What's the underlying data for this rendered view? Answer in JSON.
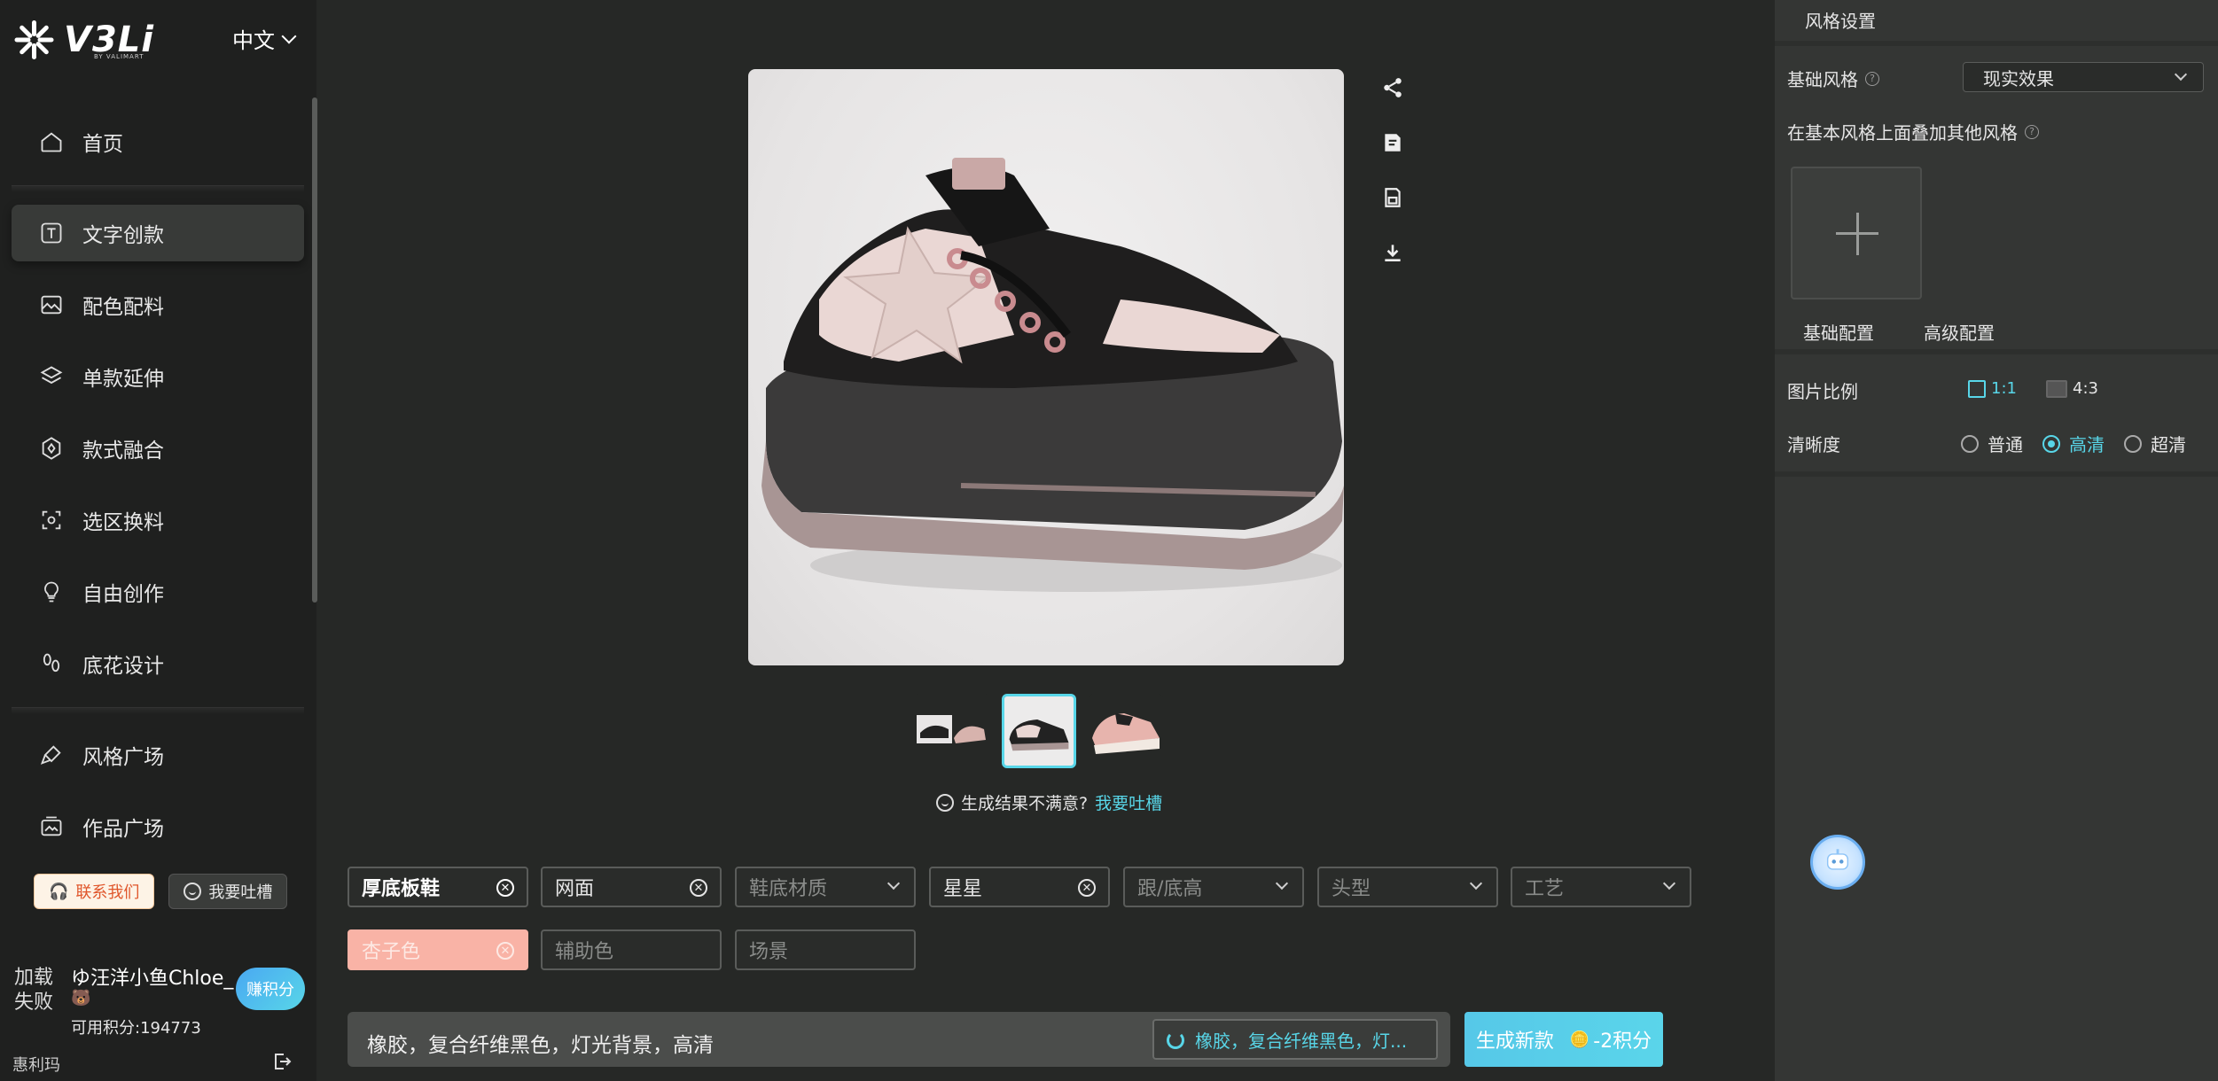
{
  "brand": {
    "logo_text": "V3Li",
    "logo_sub": "BY VALIMART"
  },
  "header": {
    "language": "中文"
  },
  "sidebar": {
    "items": [
      {
        "label": "首页",
        "icon": "home-icon"
      },
      {
        "label": "文字创款",
        "icon": "text-icon",
        "active": true
      },
      {
        "label": "配色配料",
        "icon": "palette-icon"
      },
      {
        "label": "单款延伸",
        "icon": "layers-icon"
      },
      {
        "label": "款式融合",
        "icon": "fusion-icon"
      },
      {
        "label": "选区换料",
        "icon": "select-area-icon"
      },
      {
        "label": "自由创作",
        "icon": "lightbulb-icon"
      },
      {
        "label": "底花设计",
        "icon": "footprint-icon"
      }
    ],
    "items2": [
      {
        "label": "风格广场",
        "icon": "brush-icon"
      },
      {
        "label": "作品广场",
        "icon": "gallery-icon"
      }
    ],
    "contact_label": "联系我们",
    "feedback_label": "我要吐槽"
  },
  "user": {
    "avatar_fail": "加载失败",
    "name": "ゆ汪洋小鱼Chloe_",
    "emoji": "🐻",
    "points_label": "可用积分:194773",
    "earn_label": "赚积分",
    "shop": "惠利玛"
  },
  "main": {
    "dissatisfied_text": "生成结果不满意?",
    "feedback_link": "我要吐槽",
    "tags": [
      {
        "value": "厚底板鞋",
        "type": "filled-bold"
      },
      {
        "value": "网面",
        "type": "filled"
      },
      {
        "placeholder": "鞋底材质",
        "type": "dropdown"
      },
      {
        "value": "星星",
        "type": "filled"
      },
      {
        "placeholder": "跟/底高",
        "type": "dropdown"
      },
      {
        "placeholder": "头型",
        "type": "dropdown"
      },
      {
        "placeholder": "工艺",
        "type": "dropdown"
      },
      {
        "value": "杏子色",
        "type": "pink"
      },
      {
        "placeholder": "辅助色",
        "type": "empty"
      },
      {
        "placeholder": "场景",
        "type": "empty"
      }
    ],
    "prompt": "橡胶，复合纤维黑色，灯光背景，高清",
    "prompt_chip": "橡胶，复合纤维黑色，灯...",
    "generate_label": "生成新款",
    "cost_label": "-2积分"
  },
  "panel": {
    "title": "风格设置",
    "base_style_label": "基础风格",
    "base_style_value": "现实效果",
    "overlay_label": "在基本风格上面叠加其他风格",
    "tab_basic": "基础配置",
    "tab_advanced": "高级配置",
    "ratio_label": "图片比例",
    "ratio_options": [
      "1:1",
      "4:3"
    ],
    "ratio_selected": "1:1",
    "clarity_label": "清晰度",
    "clarity_options": [
      "普通",
      "高清",
      "超清"
    ],
    "clarity_selected": "高清"
  },
  "colors": {
    "accent": "#58d6e8",
    "sidebar_bg": "#1f201f",
    "main_bg": "#262826",
    "panel_bg": "#343634",
    "pink_tag": "#f9b3a6"
  }
}
